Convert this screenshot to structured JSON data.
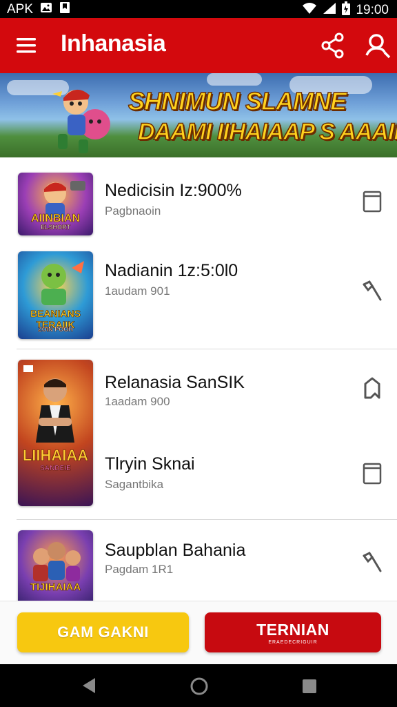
{
  "status_bar": {
    "left_label": "APK",
    "time": "19:00"
  },
  "app_bar": {
    "title": "Inhanasia",
    "icons": [
      "menu-icon",
      "share-icon",
      "profile-search-icon"
    ]
  },
  "banner": {
    "line1": "SHNIMUN SLAMNE",
    "line2": "DAAMI IIHAIAAP S AAAIK!"
  },
  "list": {
    "items": [
      {
        "title": "Nedicisin Iz:900%",
        "subtitle": "Pagbnaoin",
        "thumb_text": "AIINBIAN",
        "thumb_sub": "ELSHORT",
        "action_icon": "bookmark-icon"
      },
      {
        "title": "Nadianin 1z:5:0l0",
        "subtitle": "1audam 901",
        "thumb_text": "BEANIANS TERAIIK",
        "thumb_sub": "ZOIN POOH",
        "action_icon": "tool-icon"
      },
      {
        "title": "Relanasia SanSIK",
        "subtitle": "1aadam 900",
        "thumb_text": "LIIHAIAA",
        "thumb_sub": "SANDEIE",
        "action_icon": "tag-icon"
      },
      {
        "title": "Tlryin Sknai",
        "subtitle": "Sagantbika",
        "action_icon": "bookmark-icon"
      },
      {
        "title": "Saupblan Bahania",
        "subtitle": "Pagdam 1R1",
        "thumb_text": "TIJIHAIAA",
        "action_icon": "tool-icon"
      }
    ]
  },
  "buttons": {
    "primary": "GAM GAKNI",
    "secondary": "TERNIAN",
    "secondary_small": "ERAEDECRIGUIR"
  }
}
